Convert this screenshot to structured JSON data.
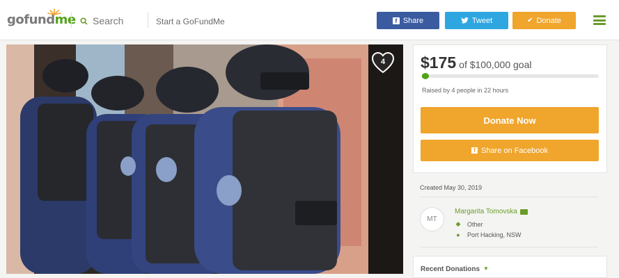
{
  "header": {
    "logo_prefix": "gofund",
    "logo_suffix": "me",
    "search_label": "Search",
    "start_link": "Start a GoFundMe",
    "share_label": "Share",
    "tweet_label": "Tweet",
    "donate_label": "Donate"
  },
  "hero": {
    "heart_count": "4"
  },
  "campaign": {
    "raised_amount": "$175",
    "goal_text": "of $100,000 goal",
    "progress_fraction": 0.00175,
    "raised_note": "Raised by 4 people in 22 hours",
    "donate_now_label": "Donate Now",
    "share_facebook_label": "Share on Facebook",
    "created": "Created May 30, 2019"
  },
  "organizer": {
    "initials": "MT",
    "name": "Margarita Tomovska",
    "category": "Other",
    "location": "Port Hacking, NSW"
  },
  "recent_donations_label": "Recent Donations",
  "colors": {
    "brand_green": "#53a318",
    "facebook_blue": "#3a5ba0",
    "twitter_blue": "#2ea7e0",
    "donate_orange": "#f0a52d"
  }
}
